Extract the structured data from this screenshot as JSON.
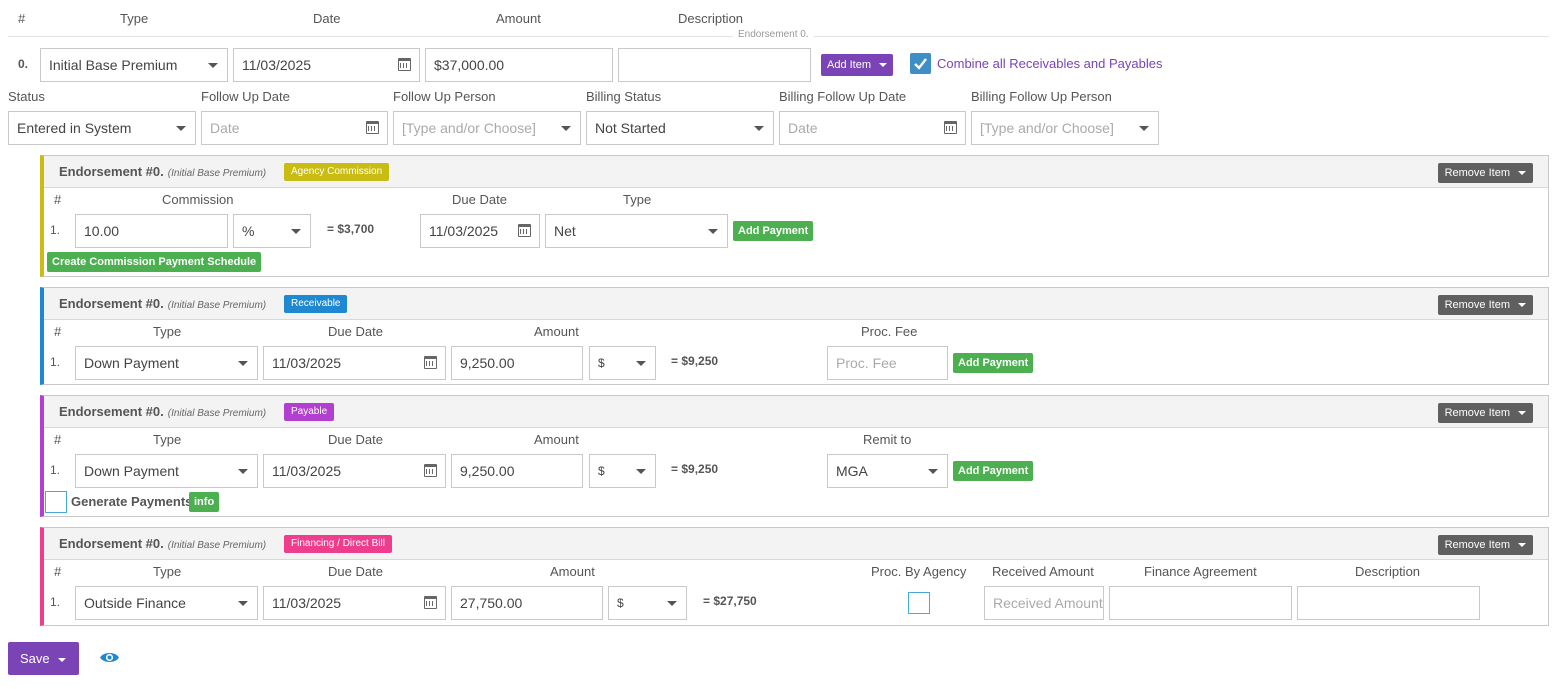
{
  "top_headers": {
    "num": "#",
    "type": "Type",
    "date": "Date",
    "amount": "Amount",
    "description": "Description"
  },
  "endorsement_note": "Endorsement 0.",
  "main_row": {
    "num": "0.",
    "type": "Initial Base Premium",
    "date": "11/03/2025",
    "amount": "$37,000.00",
    "description": "",
    "add_item_label": "Add Item",
    "combine_label": "Combine all Receivables and Payables",
    "combine_checked": true
  },
  "status_headers": {
    "status": "Status",
    "follow_up_date": "Follow Up Date",
    "follow_up_person": "Follow Up Person",
    "billing_status": "Billing Status",
    "billing_follow_up_date": "Billing Follow Up Date",
    "billing_follow_up_person": "Billing Follow Up Person"
  },
  "status_row": {
    "status": "Entered in System",
    "follow_up_date_placeholder": "Date",
    "follow_up_person_placeholder": "[Type and/or Choose]",
    "billing_status": "Not Started",
    "billing_follow_up_date_placeholder": "Date",
    "billing_follow_up_person_placeholder": "[Type and/or Choose]"
  },
  "panels": {
    "commission": {
      "title": "Endorsement #0.",
      "subtitle": "(Initial Base Premium)",
      "tag": "Agency Commission",
      "tag_color": "#c9bd13",
      "remove_label": "Remove Item",
      "headers": {
        "num": "#",
        "commission": "Commission",
        "due_date": "Due Date",
        "type": "Type"
      },
      "row": {
        "num": "1.",
        "commission": "10.00",
        "unit": "%",
        "computed": "= $3,700",
        "due_date": "11/03/2025",
        "type": "Net"
      },
      "add_payment_label": "Add Payment",
      "schedule_label": "Create Commission Payment Schedule"
    },
    "receivable": {
      "title": "Endorsement #0.",
      "subtitle": "(Initial Base Premium)",
      "tag": "Receivable",
      "tag_color": "#1e88d2",
      "remove_label": "Remove Item",
      "headers": {
        "num": "#",
        "type": "Type",
        "due_date": "Due Date",
        "amount": "Amount",
        "proc_fee": "Proc. Fee"
      },
      "row": {
        "num": "1.",
        "type": "Down Payment",
        "due_date": "11/03/2025",
        "amount": "9,250.00",
        "unit": "$",
        "computed": "= $9,250",
        "proc_fee_placeholder": "Proc. Fee"
      },
      "add_payment_label": "Add Payment"
    },
    "payable": {
      "title": "Endorsement #0.",
      "subtitle": "(Initial Base Premium)",
      "tag": "Payable",
      "tag_color": "#b33fd1",
      "remove_label": "Remove Item",
      "headers": {
        "num": "#",
        "type": "Type",
        "due_date": "Due Date",
        "amount": "Amount",
        "remit_to": "Remit to"
      },
      "row": {
        "num": "1.",
        "type": "Down Payment",
        "due_date": "11/03/2025",
        "amount": "9,250.00",
        "unit": "$",
        "computed": "= $9,250",
        "remit_to": "MGA"
      },
      "add_payment_label": "Add Payment",
      "generate_label": "Generate Payments",
      "info_label": "info"
    },
    "financing": {
      "title": "Endorsement #0.",
      "subtitle": "(Initial Base Premium)",
      "tag": "Financing / Direct Bill",
      "tag_color": "#ee3d8c",
      "remove_label": "Remove Item",
      "headers": {
        "num": "#",
        "type": "Type",
        "due_date": "Due Date",
        "amount": "Amount",
        "proc_by_agency": "Proc. By Agency",
        "received_amount": "Received Amount",
        "finance_agreement": "Finance Agreement",
        "description": "Description"
      },
      "row": {
        "num": "1.",
        "type": "Outside Finance",
        "due_date": "11/03/2025",
        "amount": "27,750.00",
        "unit": "$",
        "computed": "= $27,750",
        "received_placeholder": "Received Amount",
        "finance_agreement": "",
        "description": ""
      }
    }
  },
  "footer": {
    "save_label": "Save"
  },
  "colors": {
    "accent_purple": "#7a43b6",
    "accent_green": "#4caf50",
    "link_blue": "#1e88d2"
  }
}
